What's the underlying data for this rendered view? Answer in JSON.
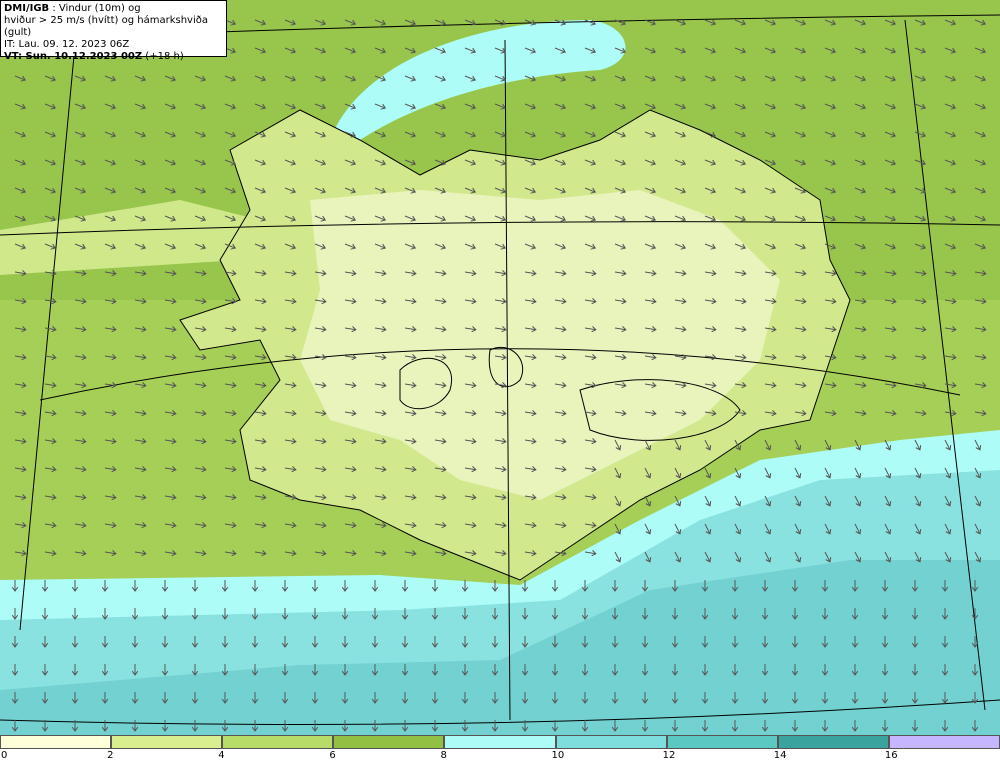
{
  "header": {
    "model": "DMI/IGB",
    "title_rest": " : Vindur (10m) og",
    "line2": "hviður > 25 m/s (hvítt) og hámarkshviða (gult)",
    "line3": "IT: Lau. 09. 12. 2023 06Z",
    "vt_bold": "VT: Sun. 10.12.2023 00Z",
    "vt_rest": " (+18 h)"
  },
  "legend": {
    "ticks": [
      "0",
      "2",
      "4",
      "6",
      "8",
      "10",
      "12",
      "14",
      "16"
    ],
    "colors": [
      "#ffffd9",
      "#d9ef8f",
      "#b7dc67",
      "#91c043",
      "#aefcf7",
      "#7ddedd",
      "#5cc8c2",
      "#3ba39e",
      "#c6b6ff"
    ]
  },
  "map_colors": {
    "sea_north": "#9fcb52",
    "sea_south": "#6fd0cf",
    "land_light": "#e6f2b4",
    "land_mid": "#c8e27a",
    "cyan_band": "#aefcf7",
    "arrow": "#555555"
  }
}
